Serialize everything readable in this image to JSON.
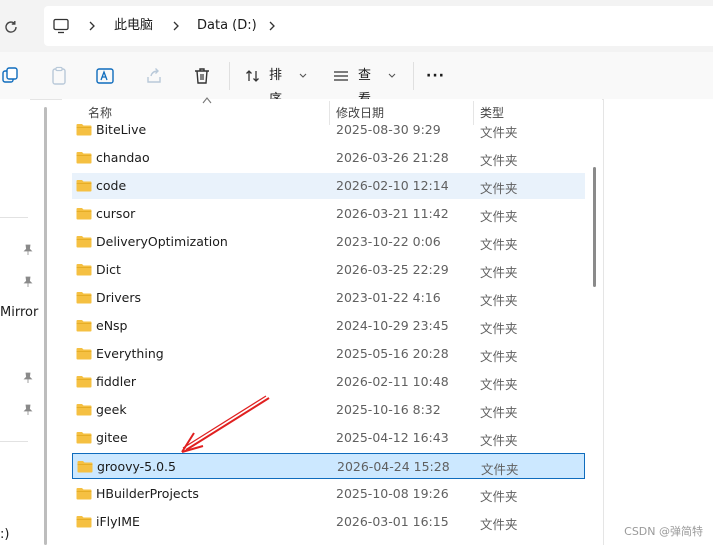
{
  "address": {
    "crumbs": [
      "此电脑",
      "Data (D:)"
    ]
  },
  "toolbar": {
    "sort_label": "排序",
    "view_label": "查看",
    "more_label": "···"
  },
  "nav": {
    "mirror_label": "Mirror",
    "bottom_label": ":)"
  },
  "columns": {
    "name": "名称",
    "date": "修改日期",
    "type": "类型"
  },
  "files": [
    {
      "name": "BiteLive",
      "date": "2025-08-30 9:29",
      "type": "文件夹"
    },
    {
      "name": "chandao",
      "date": "2026-03-26 21:28",
      "type": "文件夹"
    },
    {
      "name": "code",
      "date": "2026-02-10 12:14",
      "type": "文件夹"
    },
    {
      "name": "cursor",
      "date": "2026-03-21 11:42",
      "type": "文件夹"
    },
    {
      "name": "DeliveryOptimization",
      "date": "2023-10-22 0:06",
      "type": "文件夹"
    },
    {
      "name": "Dict",
      "date": "2026-03-25 22:29",
      "type": "文件夹"
    },
    {
      "name": "Drivers",
      "date": "2023-01-22 4:16",
      "type": "文件夹"
    },
    {
      "name": "eNsp",
      "date": "2024-10-29 23:45",
      "type": "文件夹"
    },
    {
      "name": "Everything",
      "date": "2025-05-16 20:28",
      "type": "文件夹"
    },
    {
      "name": "fiddler",
      "date": "2026-02-11 10:48",
      "type": "文件夹"
    },
    {
      "name": "geek",
      "date": "2025-10-16 8:32",
      "type": "文件夹"
    },
    {
      "name": "gitee",
      "date": "2025-04-12 16:43",
      "type": "文件夹"
    },
    {
      "name": "groovy-5.0.5",
      "date": "2026-04-24 15:28",
      "type": "文件夹"
    },
    {
      "name": "HBuilderProjects",
      "date": "2025-10-08 19:26",
      "type": "文件夹"
    },
    {
      "name": "iFlyIME",
      "date": "2026-03-01 16:15",
      "type": "文件夹"
    }
  ],
  "watermark": "CSDN @弹简特",
  "colors": {
    "accent": "#0f6cbd",
    "selection": "#cce8ff",
    "hover": "#e9f2fb",
    "folder": "#f5c042",
    "annotation_arrow": "#e02020"
  }
}
